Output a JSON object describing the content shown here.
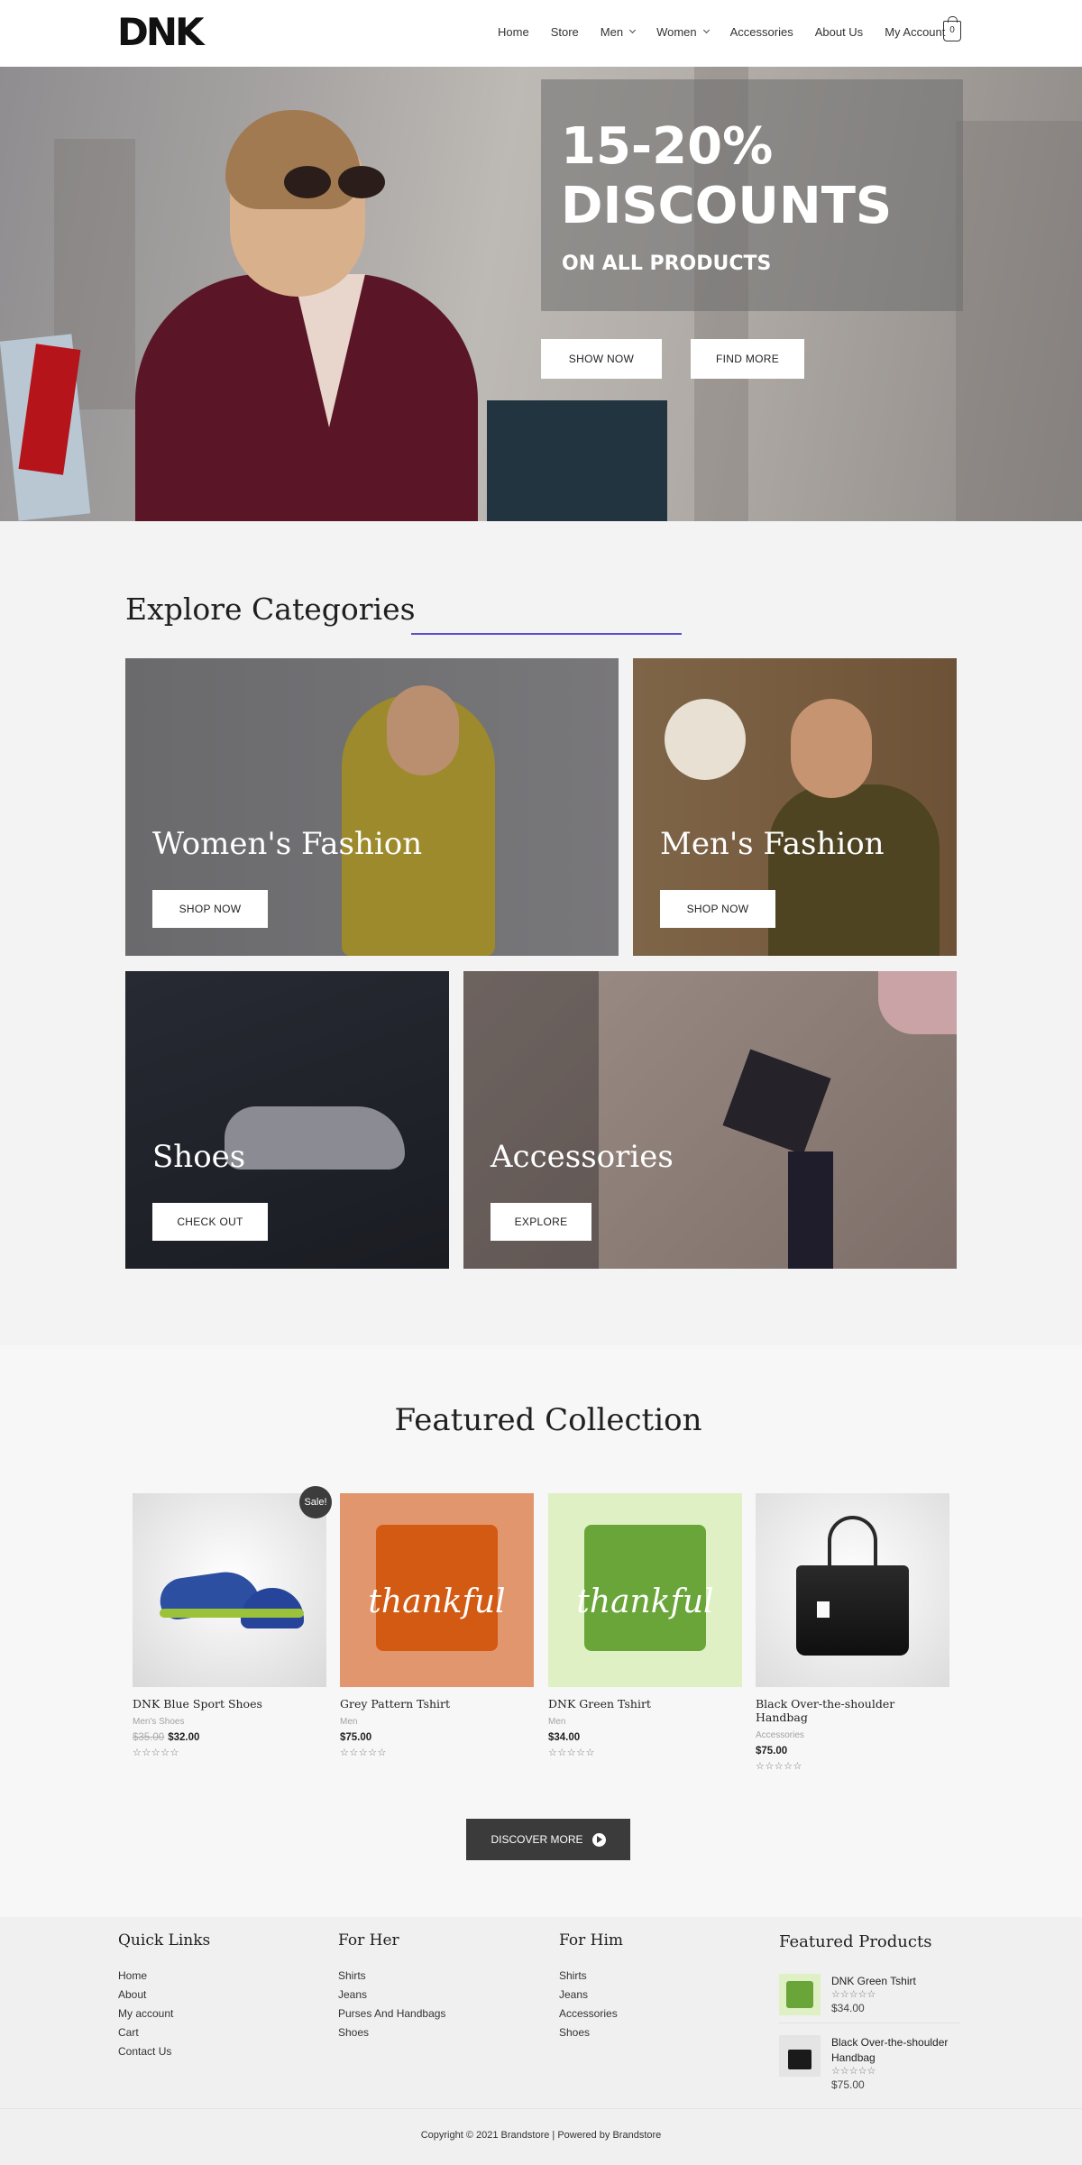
{
  "brand": {
    "logo": "DNK"
  },
  "nav": {
    "items": [
      {
        "label": "Home",
        "dropdown": false
      },
      {
        "label": "Store",
        "dropdown": false
      },
      {
        "label": "Men",
        "dropdown": true
      },
      {
        "label": "Women",
        "dropdown": true
      },
      {
        "label": "Accessories",
        "dropdown": false
      },
      {
        "label": "About Us",
        "dropdown": false
      },
      {
        "label": "My Account",
        "dropdown": false
      }
    ],
    "cart_count": "0"
  },
  "hero": {
    "line1": "15-20%",
    "line2": "DISCOUNTS",
    "subtitle": "ON ALL PRODUCTS",
    "show_now": "SHOW NOW",
    "find_more": "FIND MORE"
  },
  "categories": {
    "title": "Explore Categories",
    "accent_color": "#5b4fcf",
    "cards": [
      {
        "title": "Women's Fashion",
        "button": "SHOP NOW"
      },
      {
        "title": "Men's Fashion",
        "button": "SHOP NOW"
      },
      {
        "title": "Shoes",
        "button": "CHECK OUT"
      },
      {
        "title": "Accessories",
        "button": "EXPLORE"
      }
    ]
  },
  "featured": {
    "title": "Featured Collection",
    "products": [
      {
        "name": "DNK Blue Sport Shoes",
        "category": "Men's Shoes",
        "old_price": "$35.00",
        "price": "$32.00",
        "badge": "Sale!",
        "stars": "☆☆☆☆☆"
      },
      {
        "name": "Grey Pattern Tshirt",
        "category": "Men",
        "price": "$75.00",
        "stars": "☆☆☆☆☆",
        "print": "thankful"
      },
      {
        "name": "DNK Green Tshirt",
        "category": "Men",
        "price": "$34.00",
        "stars": "☆☆☆☆☆",
        "print": "thankful"
      },
      {
        "name": "Black Over-the-shoulder Handbag",
        "category": "Accessories",
        "price": "$75.00",
        "stars": "☆☆☆☆☆"
      }
    ],
    "discover_button": "DISCOVER MORE"
  },
  "footer": {
    "quick_links": {
      "title": "Quick Links",
      "links": [
        "Home",
        "About",
        "My account",
        "Cart",
        "Contact Us"
      ]
    },
    "for_her": {
      "title": "For Her",
      "links": [
        "Shirts",
        "Jeans",
        "Purses And Handbags",
        "Shoes"
      ]
    },
    "for_him": {
      "title": "For Him",
      "links": [
        "Shirts",
        "Jeans",
        "Accessories",
        "Shoes"
      ]
    },
    "featured_products": {
      "title": "Featured Products",
      "items": [
        {
          "name": "DNK Green Tshirt",
          "stars": "☆☆☆☆☆",
          "price": "$34.00"
        },
        {
          "name": "Black Over-the-shoulder Handbag",
          "stars": "☆☆☆☆☆",
          "price": "$75.00"
        }
      ]
    },
    "copyright": "Copyright © 2021 Brandstore | Powered by Brandstore"
  }
}
